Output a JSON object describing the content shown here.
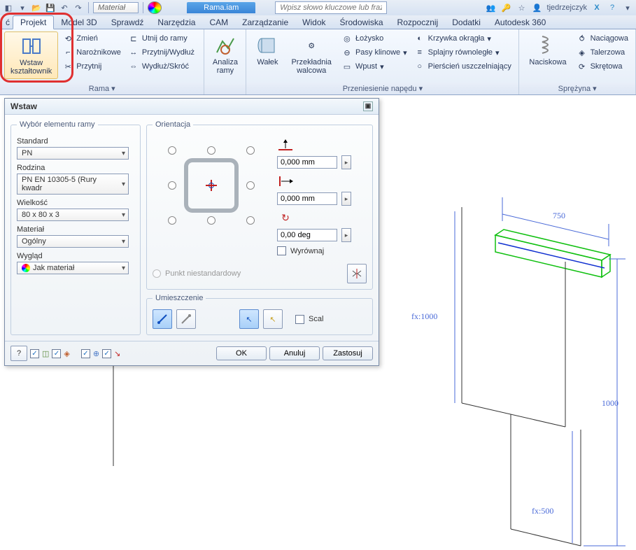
{
  "qat": {
    "material": "Materiał",
    "doc": "Rama.iam",
    "search_ph": "Wpisz słowo kluczowe lub frazę",
    "user": "tjedrzejczyk"
  },
  "tabs": [
    "Projekt",
    "Model 3D",
    "Sprawdź",
    "Narzędzia",
    "CAM",
    "Zarządzanie",
    "Widok",
    "Środowiska",
    "Rozpocznij",
    "Dodatki",
    "Autodesk 360"
  ],
  "ribbon": {
    "p0": {
      "big": "Wstaw\nkształtownik",
      "r": [
        "Zmień",
        "Narożnikowe",
        "Przytnij"
      ],
      "r2": [
        "Utnij do ramy",
        "Przytnij/Wydłuż",
        "Wydłuż/Skróć"
      ],
      "title": "Rama ▾"
    },
    "p1": {
      "big": "Analiza\nramy"
    },
    "p2": {
      "b": [
        "Wałek",
        "Przekładnia\nwalcowa"
      ],
      "r": [
        "Łożysko",
        "Pasy klinowe",
        "Wpust"
      ],
      "r2": [
        "Krzywka okrągła",
        "Splajny równoległe",
        "Pierścień uszczelniający"
      ],
      "title": "Przeniesienie napędu ▾"
    },
    "p3": {
      "big": "Naciskowa",
      "r": [
        "Naciągowa",
        "Talerzowa",
        "Skrętowa"
      ],
      "title": "Sprężyna ▾"
    }
  },
  "dlg": {
    "title": "Wstaw",
    "g1": "Wybór elementu ramy",
    "l_std": "Standard",
    "v_std": "PN",
    "l_fam": "Rodzina",
    "v_fam": "PN EN 10305-5 (Rury kwadr",
    "l_siz": "Wielkość",
    "v_siz": "80 x 80 x 3",
    "l_mat": "Materiał",
    "v_mat": "Ogólny",
    "l_app": "Wygląd",
    "v_app": "Jak materiał",
    "g2": "Orientacja",
    "off_x": "0,000 mm",
    "off_y": "0,000 mm",
    "off_a": "0,00 deg",
    "align": "Wyrównaj",
    "nonstd": "Punkt niestandardowy",
    "g3": "Umieszczenie",
    "merge": "Scal",
    "ok": "OK",
    "cancel": "Anuluj",
    "apply": "Zastosuj"
  },
  "dims": {
    "w": "750",
    "h": "1000",
    "fx1": "fx:1000",
    "fx2": "fx:500"
  }
}
